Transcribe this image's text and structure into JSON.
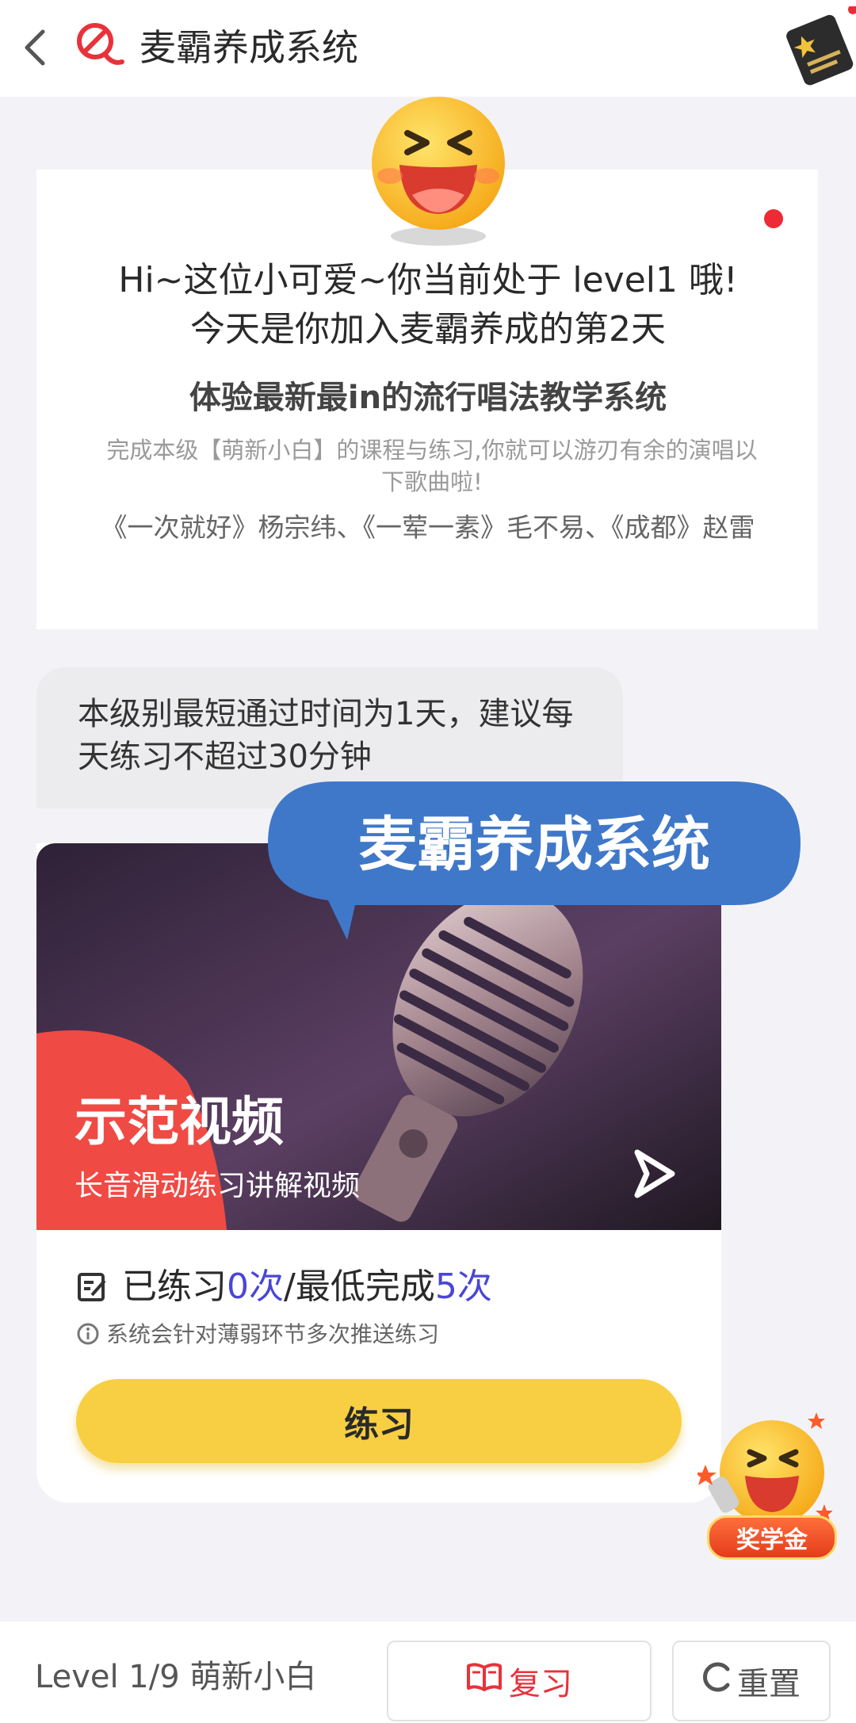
{
  "header": {
    "title": "麦霸养成系统",
    "back_icon": "chevron-left-icon",
    "brand_icon": "karaoke-logo-icon",
    "badge_icon": "achievement-badge-icon"
  },
  "intro": {
    "greeting_line1": "Hi~这位小可爱~你当前处于 level1 哦!",
    "greeting_line2": "今天是你加入麦霸养成的第2天",
    "headline": "体验最新最in的流行唱法教学系统",
    "description": "完成本级【萌新小白】的课程与练习,你就可以游刃有余的演唱以下歌曲啦!",
    "songs": "《一次就好》杨宗纬、《一荤一素》毛不易、《成都》赵雷"
  },
  "tip": {
    "text": "本级别最短通过时间为1天，建议每天练习不超过30分钟"
  },
  "overlay": {
    "text": "麦霸养成系统"
  },
  "video": {
    "title": "示范视频",
    "subtitle": "长音滑动练习讲解视频"
  },
  "practice": {
    "prefix": "已练习",
    "done_count": "0次",
    "separator": "/最低完成",
    "required_count": "5次",
    "notice": "系统会针对薄弱环节多次推送练习",
    "button_label": "练习"
  },
  "scholarship": {
    "label": "奖学金"
  },
  "footer": {
    "level_text": "Level 1/9 萌新小白",
    "review_label": "复习",
    "reset_label": "重置"
  },
  "colors": {
    "accent_yellow": "#f8cf43",
    "accent_red": "#e8323a",
    "count_highlight": "#4a46d6",
    "overlay_blue": "#3f78c9"
  }
}
